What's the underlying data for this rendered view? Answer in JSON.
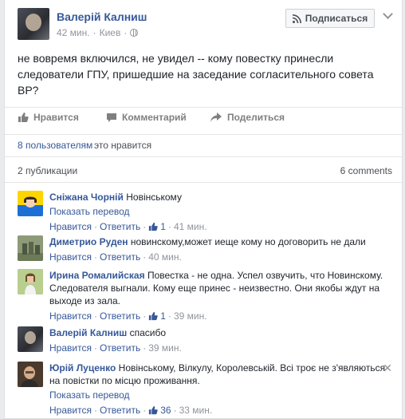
{
  "post": {
    "author": "Валерій Калниш",
    "time": "42 мин.",
    "location": "Киев",
    "subscribe_label": "Подписаться",
    "text": "не вовремя включился, не увидел -- кому повестку принесли следователи ГПУ, пришедшие на заседание согласительного совета ВР?"
  },
  "actions": {
    "like": "Нравится",
    "comment": "Комментарий",
    "share": "Поделиться"
  },
  "likes": {
    "count_link": "8 пользователям",
    "suffix": "это нравится"
  },
  "shares": {
    "publications": "2 публикации",
    "comments_count": "6 comments"
  },
  "comments": [
    {
      "name": "Сніжана Чорній",
      "text": "Новінському",
      "translate": "Показать перевод",
      "like": "Нравится",
      "reply": "Ответить",
      "likes": "1",
      "time": "41 мин."
    },
    {
      "name": "Диметрио Руден",
      "text": "новинскому,может иеще кому но договорить не дали",
      "like": "Нравится",
      "reply": "Ответить",
      "time": "40 мин."
    },
    {
      "name": "Ирина Ромалийская",
      "text": "Повестка - не одна. Успел озвучить, что Новинскому. Следователя выгнали. Кому еще принес - неизвестно. Они якобы ждут на выходе из зала.",
      "like": "Нравится",
      "reply": "Ответить",
      "likes": "1",
      "time": "39 мин."
    },
    {
      "name": "Валерій Калниш",
      "text": "спасибо",
      "like": "Нравится",
      "reply": "Ответить",
      "time": "39 мин."
    },
    {
      "name": "Юрій Луценко",
      "text": "Новінському, Вілкулу, Королевській. Всі троє не з'являються на повістки по місцю проживання.",
      "translate": "Показать перевод",
      "like": "Нравится",
      "reply": "Ответить",
      "likes": "36",
      "time": "33 мин."
    }
  ],
  "separator": "·",
  "colors": {
    "link": "#365899",
    "muted": "#90949c",
    "border": "#e5e5e5"
  }
}
